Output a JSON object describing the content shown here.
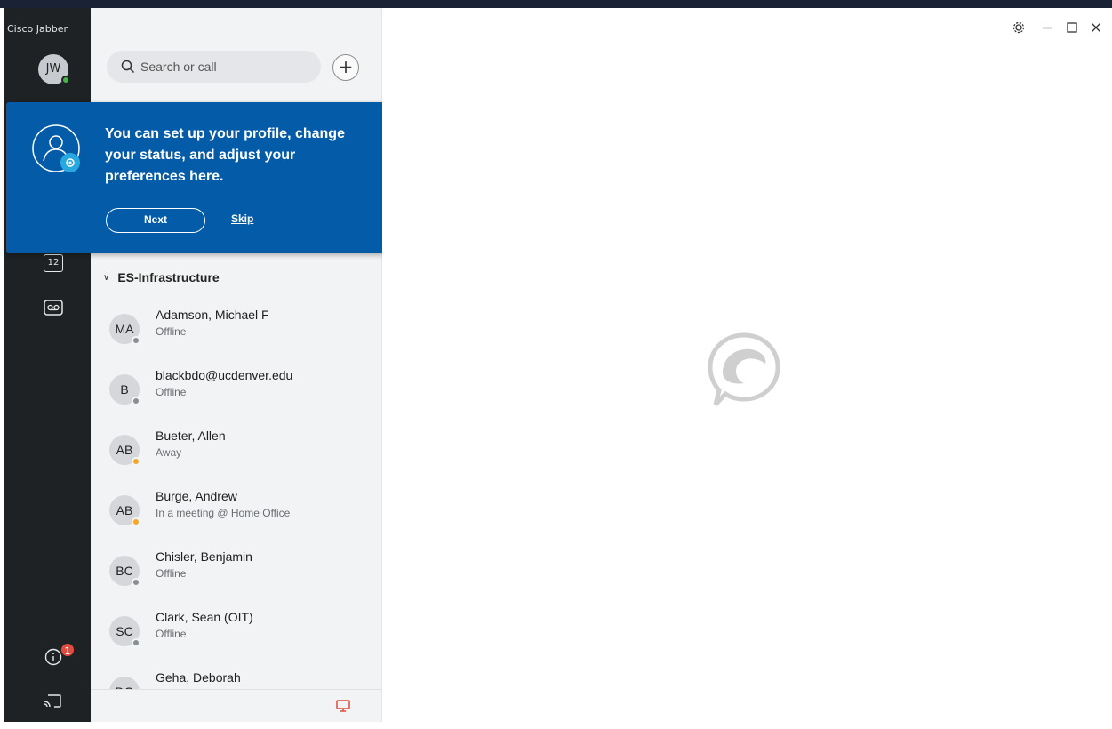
{
  "app": {
    "title": "Cisco Jabber"
  },
  "me": {
    "initials": "JW",
    "status_color": "#4ab34a"
  },
  "rail": {
    "calendar_day": "12",
    "notification_count": "1"
  },
  "search": {
    "placeholder": "Search or call"
  },
  "coach": {
    "message": "You can set up your profile, change your status, and adjust your preferences here.",
    "next_label": "Next",
    "skip_label": "Skip"
  },
  "group": {
    "name": "ES-Infrastructure"
  },
  "contacts": [
    {
      "initials": "MA",
      "name": "Adamson, Michael F",
      "status": "Offline",
      "status_color": "#8a8e93"
    },
    {
      "initials": "B",
      "name": "blackbdo@ucdenver.edu",
      "status": "Offline",
      "status_color": "#8a8e93"
    },
    {
      "initials": "AB",
      "name": "Bueter, Allen",
      "status": "Away",
      "status_color": "#f5a623"
    },
    {
      "initials": "AB",
      "name": "Burge, Andrew",
      "status": "In a meeting @ Home Office",
      "status_color": "#f5a623"
    },
    {
      "initials": "BC",
      "name": "Chisler, Benjamin",
      "status": "Offline",
      "status_color": "#8a8e93"
    },
    {
      "initials": "SC",
      "name": "Clark, Sean (OIT)",
      "status": "Offline",
      "status_color": "#8a8e93"
    },
    {
      "initials": "DG",
      "name": "Geha, Deborah",
      "status": "",
      "status_color": "#8a8e93"
    }
  ],
  "colors": {
    "coach_bg": "#045ca8",
    "rail_bg": "#1e2225",
    "accent_red": "#e34b3f"
  }
}
